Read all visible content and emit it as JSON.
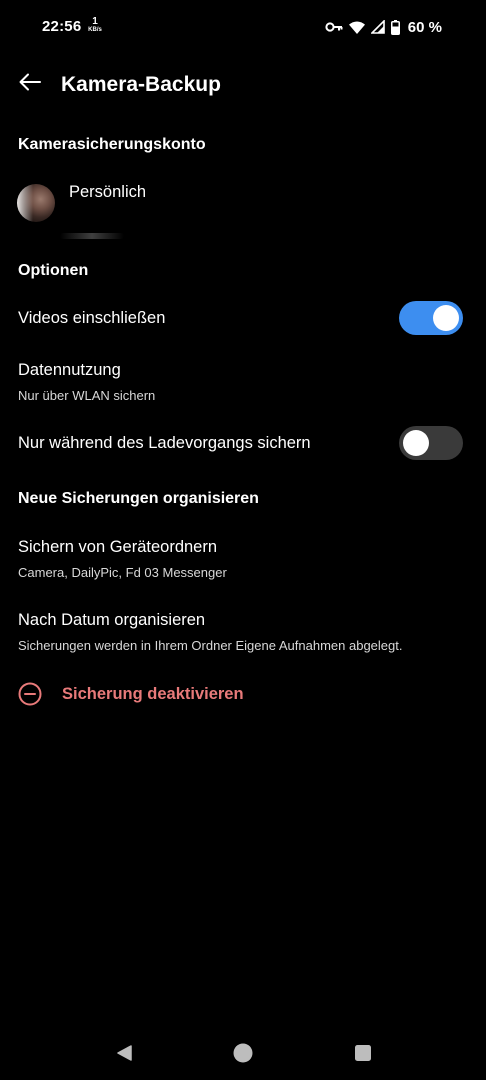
{
  "status_bar": {
    "time": "22:56",
    "net_speed_value": "1",
    "net_speed_unit": "KB/s",
    "battery_percent": "60 %",
    "icons": [
      "vpn-key-icon",
      "wifi-icon",
      "cell-signal-icon",
      "battery-icon"
    ]
  },
  "app_bar": {
    "back_icon": "arrow-left-icon",
    "title": "Kamera-Backup"
  },
  "account_section": {
    "header": "Kamerasicherungskonto",
    "account_name": "Persönlich"
  },
  "options_section": {
    "header": "Optionen",
    "include_videos": {
      "label": "Videos einschließen",
      "enabled": true
    },
    "data_usage": {
      "label": "Datennutzung",
      "value": "Nur über WLAN sichern"
    },
    "charging_only": {
      "label": "Nur während des Ladevorgangs sichern",
      "enabled": false
    }
  },
  "organize_section": {
    "header": "Neue Sicherungen organisieren",
    "device_folders": {
      "label": "Sichern von Geräteordnern",
      "value": "Camera, DailyPic, Fd 03 Messenger"
    },
    "by_date": {
      "label": "Nach Datum organisieren",
      "value": "Sicherungen werden in Ihrem Ordner Eigene Aufnahmen abgelegt."
    }
  },
  "deactivate": {
    "label": "Sicherung deaktivieren",
    "icon": "minus-circle-icon",
    "color": "#e87a7a"
  },
  "colors": {
    "background": "#000000",
    "accent": "#3d8ef0",
    "toggle_off_track": "#3a3a3a"
  },
  "nav_bar": {
    "icons": [
      "back-triangle-icon",
      "home-circle-icon",
      "recents-square-icon"
    ]
  }
}
